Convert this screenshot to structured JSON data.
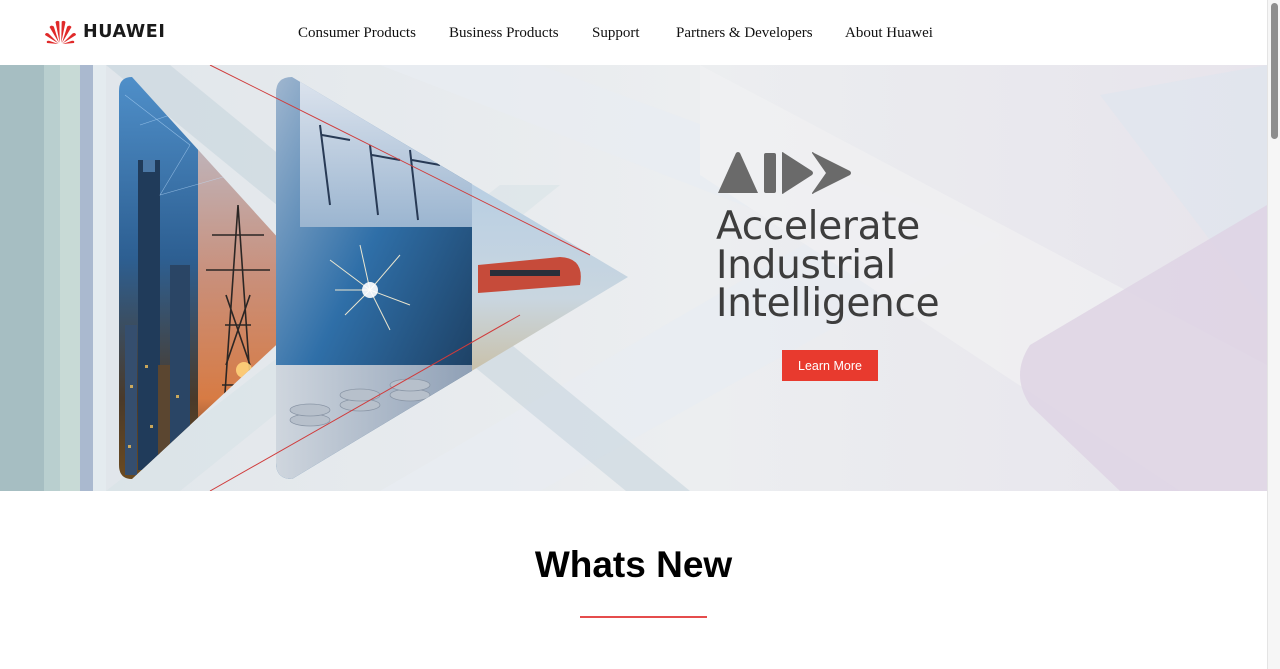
{
  "header": {
    "brand": "HUAWEI",
    "nav": [
      {
        "label": "Consumer Products"
      },
      {
        "label": "Business Products"
      },
      {
        "label": "Support"
      },
      {
        "label": "Partners & Developers"
      },
      {
        "label": "About Huawei"
      }
    ]
  },
  "hero": {
    "title_lines": [
      "Accelerate",
      "Industrial",
      "Intelligence"
    ],
    "cta_label": "Learn More",
    "images": [
      "city-skyline",
      "power-tower",
      "industrial-welding",
      "port-cranes",
      "high-speed-train",
      "coin-stacks"
    ]
  },
  "section": {
    "title": "Whats New"
  },
  "colors": {
    "brand_red": "#e83a2e",
    "underline": "#e54c4c",
    "hero_text": "#3d3d3d",
    "hero_mark": "#666666"
  }
}
